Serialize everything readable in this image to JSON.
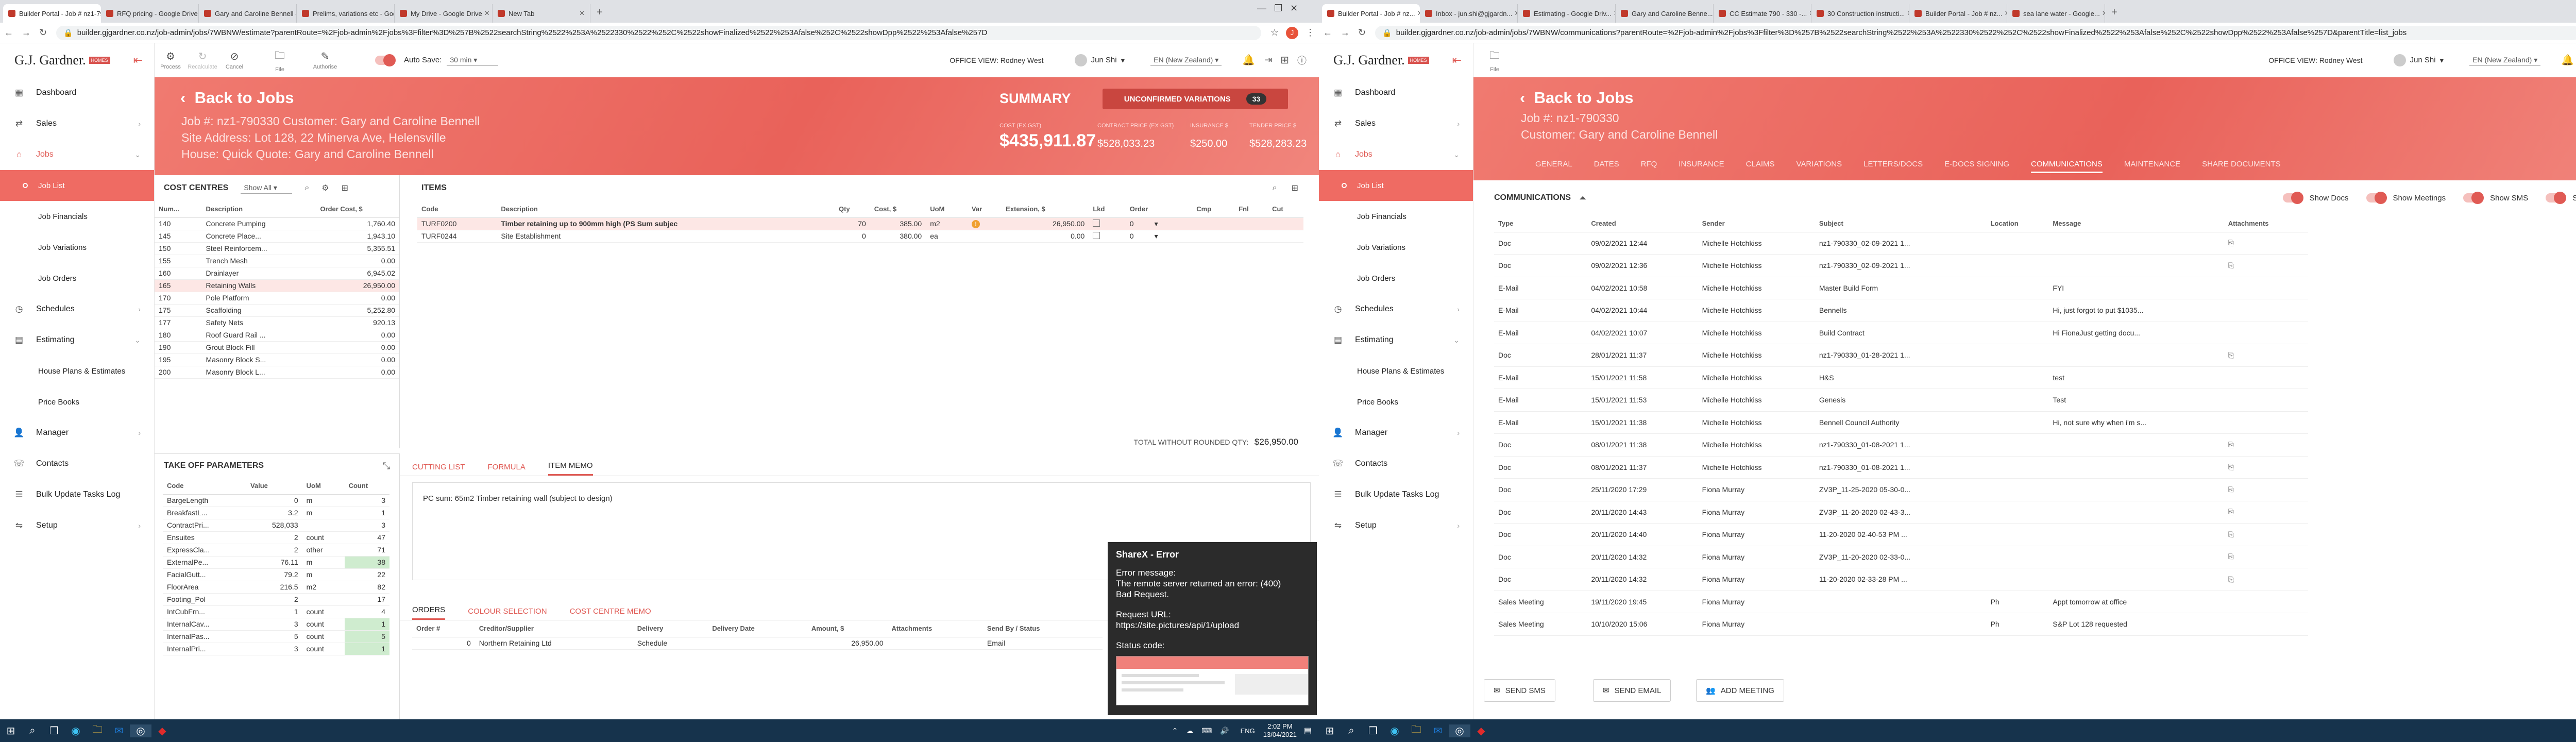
{
  "left_browser": {
    "tabs": [
      "Builder Portal - Job # nz1-7903...",
      "RFQ pricing - Google Drive",
      "Gary and Caroline Bennell - ZV3...",
      "Prelims, variations etc - Google...",
      "My Drive - Google Drive",
      "New Tab"
    ],
    "url": "builder.gjgardner.co.nz/job-admin/jobs/7WBNW/estimate?parentRoute=%2Fjob-admin%2Fjobs%3Ffilter%3D%257B%2522searchString%2522%253A%2522330%2522%252C%2522showFinalized%2522%253Afalse%252C%2522showDpp%2522%253Afalse%257D",
    "profile": "J"
  },
  "right_browser": {
    "tabs": [
      "Builder Portal - Job # nz...",
      "Inbox - jun.shi@gjgardn...",
      "Estimating - Google Driv...",
      "Gary and Caroline Benne...",
      "CC Estimate 790 - 330 -...",
      "30 Construction instructi...",
      "Builder Portal - Job # nz...",
      "sea lane water - Google..."
    ],
    "url": "builder.gjgardner.co.nz/job-admin/jobs/7WBNW/communications?parentRoute=%2Fjob-admin%2Fjobs%3Ffilter%3D%257B%2522searchString%2522%253A%2522330%2522%252C%2522showFinalized%2522%253Afalse%252C%2522showDpp%2522%253Afalse%257D&parentTitle=list_jobs",
    "profile": "J"
  },
  "brand": {
    "name": "G.J. Gardner.",
    "badge": "HOMES"
  },
  "sidebar": {
    "items": [
      "Dashboard",
      "Sales",
      "Jobs"
    ],
    "jobs_sub": [
      "Job List",
      "Job Financials",
      "Job Variations",
      "Job Orders"
    ],
    "items2": [
      "Schedules",
      "Estimating"
    ],
    "est_sub": [
      "House Plans & Estimates",
      "Price Books"
    ],
    "items3": [
      "Manager",
      "Contacts",
      "Bulk Update Tasks Log",
      "Setup"
    ]
  },
  "toolbar": {
    "process": "Process",
    "recalculate": "Recalculate",
    "cancel": "Cancel",
    "file": "File",
    "authorise": "Authorise",
    "auto_save": "Auto Save:",
    "auto_save_val": "30 min",
    "office_view": "OFFICE VIEW: Rodney West",
    "user": "Jun Shi",
    "region": "EN (New Zealand)"
  },
  "job": {
    "back": "Back to Jobs",
    "line1": "Job #: nz1-790330 Customer: Gary and Caroline Bennell",
    "line2": "Site Address: Lot 128, 22 Minerva Ave, Helensville",
    "line3": "House: Quick Quote: Gary and Caroline Bennell",
    "line1b": "Job #: nz1-790330",
    "line2b": "Customer: Gary and Caroline Bennell",
    "summary": "SUMMARY",
    "unconfirmed": "UNCONFIRMED VARIATIONS",
    "unconfirmed_count": "33",
    "cost_label": "COST (EX GST)",
    "cost": "$435,911.87",
    "contract_label": "CONTRACT PRICE (EX GST)",
    "contract": "$528,033.23",
    "ins_label": "INSURANCE $",
    "ins": "$250.00",
    "tender_label": "TENDER PRICE $",
    "tender": "$528,283.23"
  },
  "cost_centres": {
    "title": "COST CENTRES",
    "filter": "Show All",
    "headers": [
      "Num...",
      "Description",
      "Order Cost, $"
    ],
    "rows": [
      [
        "140",
        "Concrete Pumping",
        "1,760.40"
      ],
      [
        "145",
        "Concrete Place...",
        "1,943.10"
      ],
      [
        "150",
        "Steel Reinforcem...",
        "5,355.51"
      ],
      [
        "155",
        "Trench Mesh",
        "0.00"
      ],
      [
        "160",
        "Drainlayer",
        "6,945.02"
      ],
      [
        "165",
        "Retaining Walls",
        "26,950.00"
      ],
      [
        "170",
        "Pole Platform",
        "0.00"
      ],
      [
        "175",
        "Scaffolding",
        "5,252.80"
      ],
      [
        "177",
        "Safety Nets",
        "920.13"
      ],
      [
        "180",
        "Roof Guard Rail ...",
        "0.00"
      ],
      [
        "190",
        "Grout Block Fill",
        "0.00"
      ],
      [
        "195",
        "Masonry Block S...",
        "0.00"
      ],
      [
        "200",
        "Masonry Block L...",
        "0.00"
      ]
    ]
  },
  "items": {
    "title": "ITEMS",
    "headers": [
      "Code",
      "Description",
      "Qty",
      "Cost, $",
      "UoM",
      "Var",
      "Extension, $",
      "Lkd",
      "Order",
      "Cmp",
      "Fnl",
      "Cut"
    ],
    "rows": [
      [
        "TURF0200",
        "Timber retaining up to 900mm high (PS Sum subjec",
        "70",
        "385.00",
        "m2",
        "26,950.00",
        "0"
      ],
      [
        "TURF0244",
        "Site Establishment",
        "0",
        "380.00",
        "ea",
        "0.00",
        "0"
      ]
    ],
    "total_label": "TOTAL WITHOUT ROUNDED QTY:",
    "total": "$26,950.00"
  },
  "takeoff": {
    "title": "TAKE OFF PARAMETERS",
    "headers": [
      "Code",
      "Value",
      "UoM",
      "Count"
    ],
    "rows": [
      [
        "BargeLength",
        "0",
        "m",
        "3"
      ],
      [
        "BreakfastL...",
        "3.2",
        "m",
        "1"
      ],
      [
        "ContractPri...",
        "528,033",
        "",
        "3"
      ],
      [
        "Ensuites",
        "2",
        "count",
        "47"
      ],
      [
        "ExpressCla...",
        "2",
        "other",
        "71"
      ],
      [
        "ExternalPe...",
        "76.11",
        "m",
        "38"
      ],
      [
        "FacialGutt...",
        "79.2",
        "m",
        "22"
      ],
      [
        "FloorArea",
        "216.5",
        "m2",
        "82"
      ],
      [
        "Footing_Pol",
        "2",
        "",
        "17"
      ],
      [
        "IntCubFrn...",
        "1",
        "count",
        "4"
      ],
      [
        "InternalCav...",
        "3",
        "count",
        "1"
      ],
      [
        "InternalPas...",
        "5",
        "count",
        "5"
      ],
      [
        "InternalPri...",
        "3",
        "count",
        "1"
      ]
    ]
  },
  "memo": {
    "tabs": [
      "CUTTING LIST",
      "FORMULA",
      "ITEM MEMO"
    ],
    "text": "PC sum: 65m2 Timber retaining wall (subject to design)"
  },
  "orders": {
    "tabs": [
      "ORDERS",
      "COLOUR SELECTION",
      "COST CENTRE MEMO"
    ],
    "headers": [
      "Order #",
      "Creditor/Supplier",
      "Delivery",
      "Delivery Date",
      "Amount, $",
      "Attachments",
      "Send By / Status"
    ],
    "row": [
      "0",
      "Northern Retaining Ltd",
      "Schedule",
      "",
      "26,950.00",
      "",
      "Email"
    ]
  },
  "sharex": {
    "title": "ShareX - Error",
    "l1": "Error message:",
    "l2": "The remote server returned an error: (400)",
    "l3": "Bad Request.",
    "l4": "Request URL:",
    "l5": "https://site.pictures/api/1/upload",
    "l6": "Status code:"
  },
  "comm": {
    "nav": [
      "GENERAL",
      "DATES",
      "RFQ",
      "INSURANCE",
      "CLAIMS",
      "VARIATIONS",
      "LETTERS/DOCS",
      "E-DOCS SIGNING",
      "COMMUNICATIONS",
      "MAINTENANCE",
      "SHARE DOCUMENTS"
    ],
    "title": "COMMUNICATIONS",
    "toggles": [
      "Show Docs",
      "Show Meetings",
      "Show SMS",
      "Show Emails"
    ],
    "headers": [
      "Type",
      "Created",
      "Sender",
      "Subject",
      "Location",
      "Message",
      "Attachments"
    ],
    "rows": [
      [
        "Doc",
        "09/02/2021 12:44",
        "Michelle Hotchkiss",
        "nz1-790330_02-09-2021 1...",
        "",
        ""
      ],
      [
        "Doc",
        "09/02/2021 12:36",
        "Michelle Hotchkiss",
        "nz1-790330_02-09-2021 1...",
        "",
        ""
      ],
      [
        "E-Mail",
        "04/02/2021 10:58",
        "Michelle Hotchkiss",
        "Master Build Form",
        "",
        "FYI"
      ],
      [
        "E-Mail",
        "04/02/2021 10:44",
        "Michelle Hotchkiss",
        "Bennells",
        "",
        "Hi, just forgot to put $1035..."
      ],
      [
        "E-Mail",
        "04/02/2021 10:07",
        "Michelle Hotchkiss",
        "Build Contract",
        "",
        "Hi FionaJust getting docu..."
      ],
      [
        "Doc",
        "28/01/2021 11:37",
        "Michelle Hotchkiss",
        "nz1-790330_01-28-2021 1...",
        "",
        ""
      ],
      [
        "E-Mail",
        "15/01/2021 11:58",
        "Michelle Hotchkiss",
        "H&S",
        "",
        "test"
      ],
      [
        "E-Mail",
        "15/01/2021 11:53",
        "Michelle Hotchkiss",
        "Genesis",
        "",
        "Test"
      ],
      [
        "E-Mail",
        "15/01/2021 11:38",
        "Michelle Hotchkiss",
        "Bennell Council Authority",
        "",
        "Hi, not sure why when i'm s..."
      ],
      [
        "Doc",
        "08/01/2021 11:38",
        "Michelle Hotchkiss",
        "nz1-790330_01-08-2021 1...",
        "",
        ""
      ],
      [
        "Doc",
        "08/01/2021 11:37",
        "Michelle Hotchkiss",
        "nz1-790330_01-08-2021 1...",
        "",
        ""
      ],
      [
        "Doc",
        "25/11/2020 17:29",
        "Fiona Murray",
        "ZV3P_11-25-2020 05-30-0...",
        "",
        ""
      ],
      [
        "Doc",
        "20/11/2020 14:43",
        "Fiona Murray",
        "ZV3P_11-20-2020 02-43-3...",
        "",
        ""
      ],
      [
        "Doc",
        "20/11/2020 14:40",
        "Fiona Murray",
        "11-20-2020 02-40-53 PM ...",
        "",
        ""
      ],
      [
        "Doc",
        "20/11/2020 14:32",
        "Fiona Murray",
        "ZV3P_11-20-2020 02-33-0...",
        "",
        ""
      ],
      [
        "Doc",
        "20/11/2020 14:32",
        "Fiona Murray",
        "11-20-2020 02-33-28 PM ...",
        "",
        ""
      ],
      [
        "Sales Meeting",
        "19/11/2020 19:45",
        "Fiona Murray",
        "",
        "Ph",
        "Appt tomorrow at office"
      ],
      [
        "Sales Meeting",
        "10/10/2020 15:06",
        "Fiona Murray",
        "",
        "Ph",
        "S&P Lot 128 requested"
      ]
    ],
    "btn_sms": "SEND SMS",
    "btn_email": "SEND EMAIL",
    "btn_meeting": "ADD MEETING"
  },
  "taskbar": {
    "time": "2:02 PM",
    "date": "13/04/2021",
    "lang": "ENG"
  }
}
